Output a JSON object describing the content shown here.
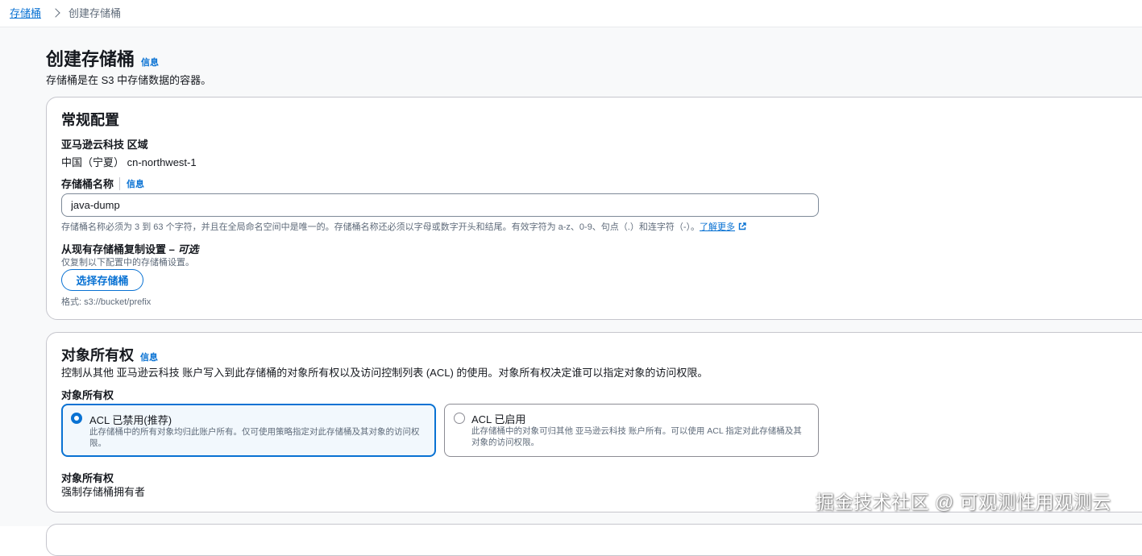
{
  "breadcrumb": {
    "parent": "存储桶",
    "current": "创建存储桶"
  },
  "page": {
    "title": "创建存储桶",
    "info": "信息",
    "description": "存储桶是在 S3 中存储数据的容器。"
  },
  "general": {
    "title": "常规配置",
    "region_label": "亚马逊云科技 区域",
    "region_value": "中国（宁夏） cn-northwest-1",
    "bucket_name_label": "存储桶名称",
    "bucket_name_info": "信息",
    "bucket_name_value": "java-dump",
    "bucket_name_hint": "存储桶名称必须为 3 到 63 个字符，并且在全局命名空间中是唯一的。存储桶名称还必须以字母或数字开头和结尾。有效字符为 a-z、0-9、句点（.）和连字符（-）。",
    "learn_more": "了解更多",
    "copy_label": "从现有存储桶复制设置 – ",
    "copy_optional": "可选",
    "copy_hint": "仅复制以下配置中的存储桶设置。",
    "choose_bucket_button": "选择存储桶",
    "format_hint": "格式: s3://bucket/prefix"
  },
  "ownership": {
    "title": "对象所有权",
    "info": "信息",
    "description": "控制从其他 亚马逊云科技 账户写入到此存储桶的对象所有权以及访问控制列表 (ACL) 的使用。对象所有权决定谁可以指定对象的访问权限。",
    "field_label": "对象所有权",
    "options": [
      {
        "title": "ACL 已禁用(推荐)",
        "desc": "此存储桶中的所有对象均归此账户所有。仅可使用策略指定对此存储桶及其对象的访问权限。",
        "selected": true
      },
      {
        "title": "ACL 已启用",
        "desc": "此存储桶中的对象可归其他 亚马逊云科技 账户所有。可以使用 ACL 指定对此存储桶及其对象的访问权限。",
        "selected": false
      }
    ],
    "result_label": "对象所有权",
    "result_value": "强制存储桶拥有者"
  },
  "watermark": "掘金技术社区 @ 可观测性用观测云",
  "colors": {
    "accent": "#0972d3",
    "selected_bg": "#f2f8fd",
    "page_bg": "#f8f9fa"
  }
}
